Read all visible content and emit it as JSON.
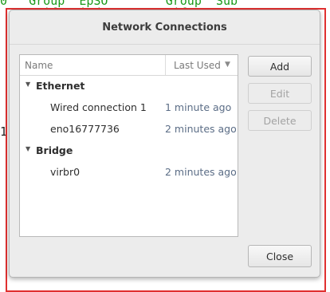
{
  "dialog": {
    "title": "Network Connections",
    "columns": {
      "name": "Name",
      "last_used": "Last Used",
      "sort_icon": "triangle-down"
    },
    "groups": [
      {
        "label": "Ethernet",
        "connections": [
          {
            "name": "Wired connection 1",
            "last_used": "1 minute ago"
          },
          {
            "name": "eno16777736",
            "last_used": "2 minutes ago"
          }
        ]
      },
      {
        "label": "Bridge",
        "connections": [
          {
            "name": "virbr0",
            "last_used": "2 minutes ago"
          }
        ]
      }
    ],
    "buttons": {
      "add": "Add",
      "edit": "Edit",
      "delete": "Delete",
      "close": "Close"
    }
  },
  "background": {
    "left_digit": "1"
  },
  "colors": {
    "frame_red": "#e03030",
    "terminal_green": "#1a9a1a",
    "time_text": "#5b6d86"
  }
}
